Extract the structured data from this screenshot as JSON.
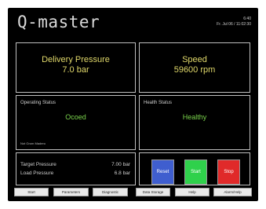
{
  "header": {
    "logo": "Q-master",
    "time": "6:40",
    "date": "Fr. Jul 06 / 11:02:30"
  },
  "delivery": {
    "label": "Delivery Pressure",
    "value": "7.0 bar"
  },
  "speed": {
    "label": "Speed",
    "value": "59600 rpm"
  },
  "operating": {
    "label": "Operating Status",
    "value": "Ocoed",
    "note": "Not Grom Madero"
  },
  "health": {
    "label": "Health Status",
    "value": "Healthy"
  },
  "params": [
    {
      "label": "Target Pressure",
      "value": "7.00 bar"
    },
    {
      "label": "Load Pressure",
      "value": "6.8 bar"
    }
  ],
  "commands": {
    "reset": "Reset",
    "start": "Start",
    "stop": "Stop"
  },
  "nav": [
    "Start",
    "Parameters",
    "Diagnostic",
    "Data Storage",
    "Help",
    "Alarm/Help"
  ],
  "colors": {
    "reset": "#3f5ecf",
    "start": "#2fd14b",
    "stop": "#e02a2a",
    "value_yellow": "#e0d86a",
    "value_green": "#7ad44c"
  }
}
